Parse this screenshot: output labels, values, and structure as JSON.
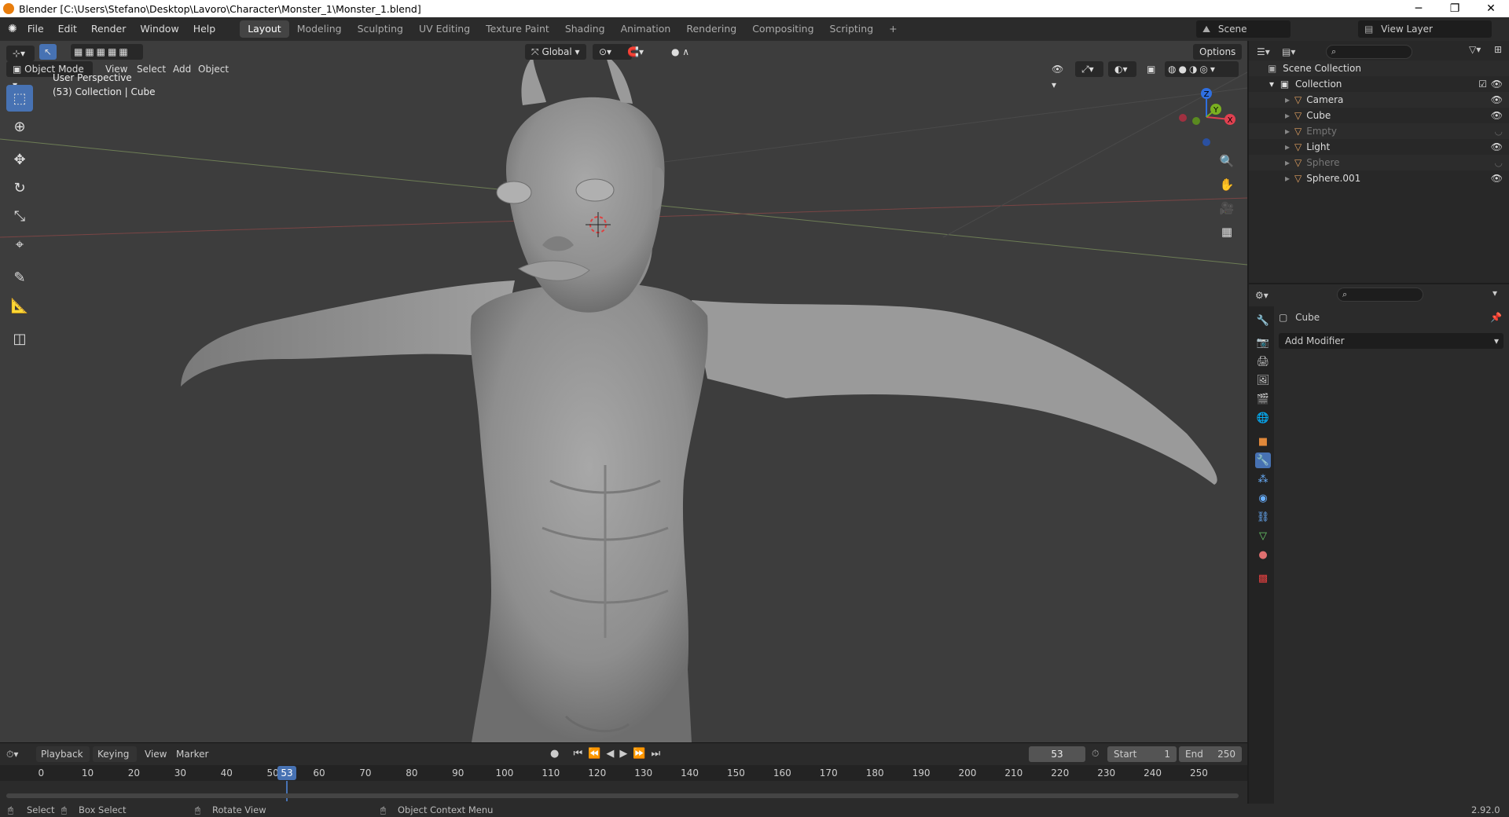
{
  "window": {
    "title": "Blender [C:\\Users\\Stefano\\Desktop\\Lavoro\\Character\\Monster_1\\Monster_1.blend]",
    "minimize": "─",
    "restore": "❐",
    "close": "✕"
  },
  "menus": [
    "File",
    "Edit",
    "Render",
    "Window",
    "Help"
  ],
  "workspaces": [
    "Layout",
    "Modeling",
    "Sculpting",
    "UV Editing",
    "Texture Paint",
    "Shading",
    "Animation",
    "Rendering",
    "Compositing",
    "Scripting"
  ],
  "active_workspace": "Layout",
  "add_workspace": "+",
  "scene": {
    "name": "Scene",
    "view_layer": "View Layer"
  },
  "viewport": {
    "mode": "Object Mode",
    "header_menus": [
      "View",
      "Select",
      "Add",
      "Object"
    ],
    "transform_orientation": "Global",
    "options": "Options",
    "overlay_title": "User Perspective",
    "overlay_sub": "(53) Collection | Cube",
    "gizmo": {
      "z": "Z",
      "y": "Y",
      "x": "X"
    }
  },
  "outliner": {
    "root": "Scene Collection",
    "collection": "Collection",
    "items": [
      {
        "name": "Camera",
        "visible": true,
        "color": "#e0a060"
      },
      {
        "name": "Cube",
        "visible": true,
        "color": "#e0a060"
      },
      {
        "name": "Empty",
        "visible": false,
        "color": "#e0a060"
      },
      {
        "name": "Light",
        "visible": true,
        "color": "#e0a060"
      },
      {
        "name": "Sphere",
        "visible": false,
        "color": "#e0a060"
      },
      {
        "name": "Sphere.001",
        "visible": true,
        "color": "#e0a060"
      }
    ]
  },
  "properties": {
    "object_name": "Cube",
    "add_modifier": "Add Modifier"
  },
  "timeline": {
    "menus": [
      "Playback",
      "Keying",
      "View",
      "Marker"
    ],
    "current_frame": "53",
    "start_label": "Start",
    "start": "1",
    "end_label": "End",
    "end": "250",
    "ticks": [
      "0",
      "10",
      "20",
      "30",
      "40",
      "50",
      "60",
      "70",
      "80",
      "90",
      "100",
      "110",
      "120",
      "130",
      "140",
      "150",
      "160",
      "170",
      "180",
      "190",
      "200",
      "210",
      "220",
      "230",
      "240",
      "250"
    ],
    "playhead": "53"
  },
  "status": {
    "select": "Select",
    "box_select": "Box Select",
    "rotate_view": "Rotate View",
    "context_menu": "Object Context Menu",
    "version": "2.92.0"
  },
  "colors": {
    "accent": "#4772b3",
    "header": "#2b2b2b",
    "viewport": "#3d3d3d"
  }
}
